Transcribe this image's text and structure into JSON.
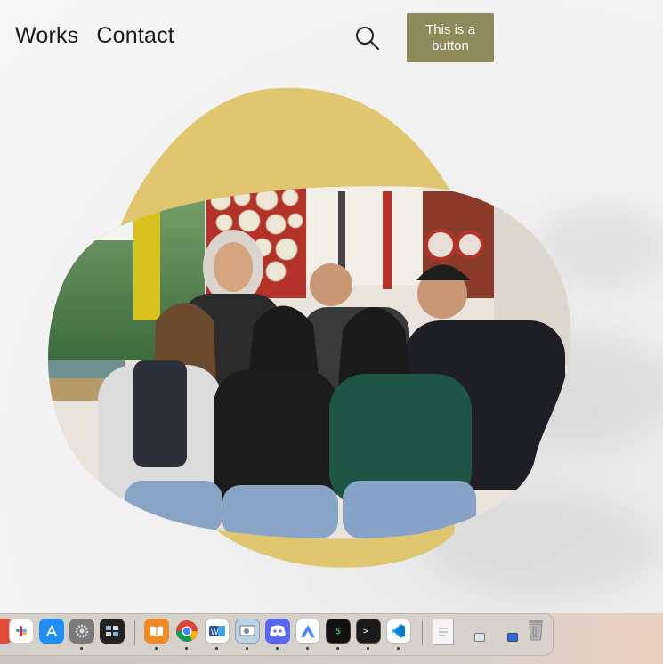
{
  "nav": {
    "works": "Works",
    "contact": "Contact"
  },
  "header": {
    "button_label": "This is a button",
    "search_icon": "search-icon"
  },
  "image": {
    "subject": "group-photo",
    "blob_color": "#e1c670"
  },
  "colors": {
    "button_bg": "#8e8a5b",
    "blob": "#e1c670"
  },
  "dock": {
    "apps": [
      {
        "name": "app-icon",
        "icon": "app-icon"
      },
      {
        "name": "slack",
        "icon": "slack-icon"
      },
      {
        "name": "app-store",
        "icon": "app-store-icon"
      },
      {
        "name": "system-settings",
        "icon": "gear-icon"
      },
      {
        "name": "mission-control",
        "icon": "grid-icon"
      },
      {
        "name": "books",
        "icon": "book-icon"
      },
      {
        "name": "chrome",
        "icon": "chrome-icon"
      },
      {
        "name": "word",
        "icon": "word-icon"
      },
      {
        "name": "preview",
        "icon": "preview-icon"
      },
      {
        "name": "discord",
        "icon": "discord-icon"
      },
      {
        "name": "nordvpn",
        "icon": "vpn-icon"
      },
      {
        "name": "terminal-dark",
        "icon": "terminal-icon"
      },
      {
        "name": "terminal",
        "icon": "terminal-icon"
      },
      {
        "name": "vscode",
        "icon": "vscode-icon"
      },
      {
        "name": "document",
        "icon": "document-icon"
      },
      {
        "name": "window-1",
        "icon": "window-icon"
      },
      {
        "name": "window-2",
        "icon": "window-icon"
      },
      {
        "name": "trash",
        "icon": "trash-icon"
      }
    ]
  }
}
